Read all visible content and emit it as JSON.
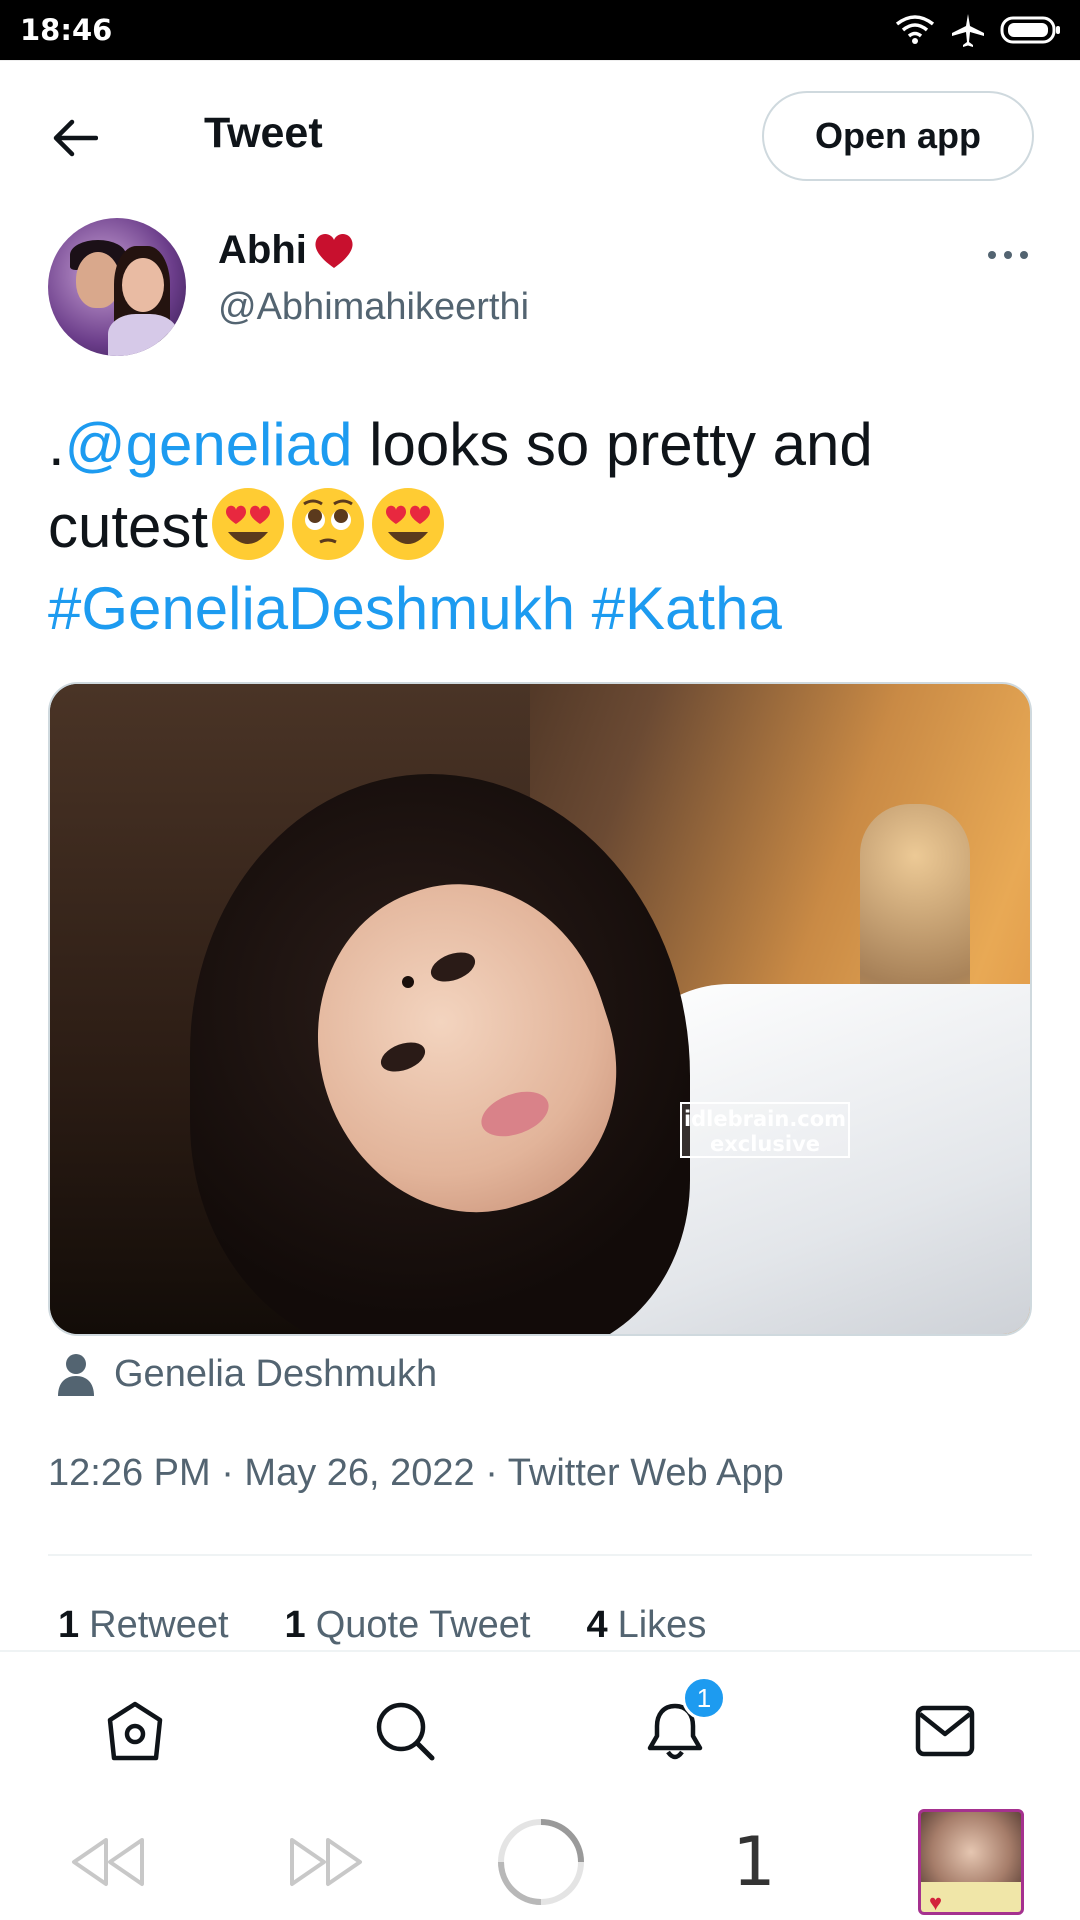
{
  "status_bar": {
    "time": "18:46",
    "icons": [
      "wifi-icon",
      "airplane-icon",
      "battery-icon"
    ]
  },
  "header": {
    "title": "Tweet",
    "open_app_label": "Open app"
  },
  "tweet": {
    "author_name": "Abhi",
    "author_handle": "@Abhimahikeerthi",
    "text_prefix": ".",
    "mention": "@geneliad",
    "text_body": " looks so pretty and cutest",
    "hashtag_1": "#GeneliaDeshmukh",
    "hashtag_2": "#Katha",
    "media_watermark_1": "idlebrain.com",
    "media_watermark_2": "exclusive",
    "tagged_person": "Genelia Deshmukh",
    "timestamp": "12:26 PM · May 26, 2022 · Twitter Web App"
  },
  "stats": {
    "retweets_count": "1",
    "retweets_label": "Retweet",
    "quotes_count": "1",
    "quotes_label": "Quote Tweet",
    "likes_count": "4",
    "likes_label": "Likes"
  },
  "bottom_nav": {
    "notification_badge": "1",
    "items": [
      "home-icon",
      "search-icon",
      "notifications-icon",
      "messages-icon"
    ]
  },
  "browser_bar": {
    "tab_count": "1"
  },
  "colors": {
    "link": "#1d9bf0",
    "text": "#0f1419",
    "secondary": "#536471",
    "heart": "#e0245e"
  }
}
